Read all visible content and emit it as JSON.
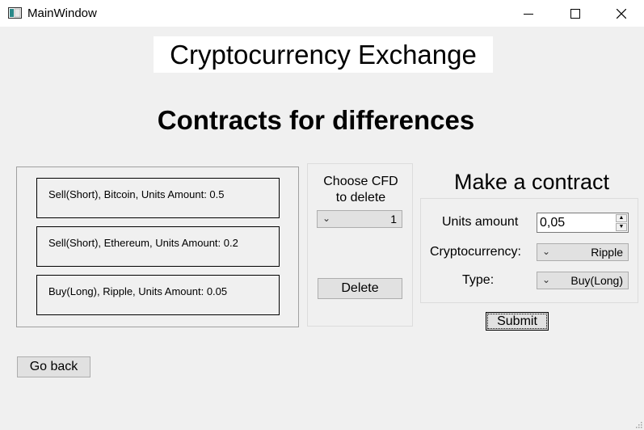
{
  "window": {
    "title": "MainWindow",
    "controls": [
      "minimize",
      "maximize",
      "close"
    ]
  },
  "header": {
    "title": "Cryptocurrency Exchange",
    "subtitle": "Contracts for differences"
  },
  "contracts": [
    {
      "text": "Sell(Short), Bitcoin, Units Amount: 0.5"
    },
    {
      "text": "Sell(Short), Ethereum, Units Amount: 0.2"
    },
    {
      "text": "Buy(Long), Ripple, Units Amount: 0.05"
    }
  ],
  "delete_panel": {
    "label_line1": "Choose CFD",
    "label_line2": "to delete",
    "selected_index": "1",
    "delete_label": "Delete"
  },
  "make_contract": {
    "title": "Make a contract",
    "units_label": "Units amount",
    "units_value": "0,05",
    "crypto_label": "Cryptocurrency:",
    "crypto_value": "Ripple",
    "type_label": "Type:",
    "type_value": "Buy(Long)",
    "submit_label": "Submit"
  },
  "footer": {
    "back_label": "Go back"
  }
}
